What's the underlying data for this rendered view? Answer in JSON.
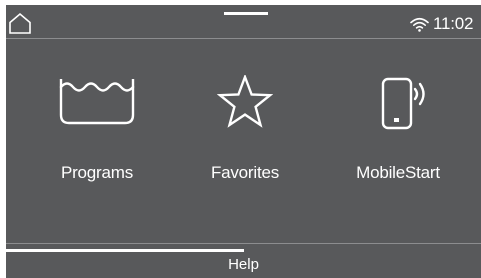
{
  "statusbar": {
    "home_icon": "home-icon",
    "wifi_icon": "wifi-icon",
    "time": "11:02"
  },
  "main": {
    "tiles": [
      {
        "label": "Programs",
        "icon": "wash-tub-icon"
      },
      {
        "label": "Favorites",
        "icon": "star-icon"
      },
      {
        "label": "MobileStart",
        "icon": "mobile-phone-signal-icon"
      }
    ]
  },
  "footer": {
    "help_label": "Help",
    "progress_fraction": 0.5
  },
  "colors": {
    "background": "#58595b",
    "foreground": "#ffffff",
    "divider": "#8c8d8f"
  }
}
